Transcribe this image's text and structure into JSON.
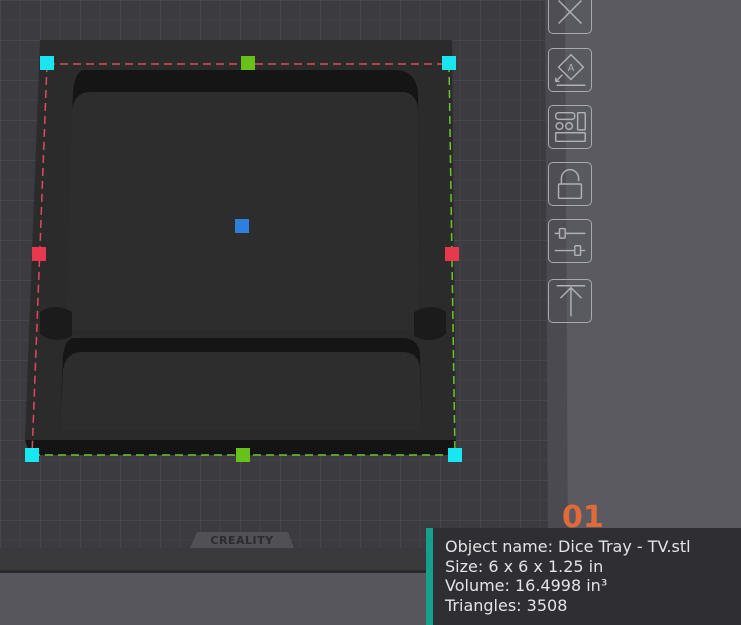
{
  "viewport": {
    "bed_logo": "CREALITY",
    "plate_number": "01"
  },
  "toolbar": {
    "tools": [
      {
        "name": "delete",
        "icon": "close-icon"
      },
      {
        "name": "auto-orient",
        "icon": "auto-orient-icon"
      },
      {
        "name": "arrange",
        "icon": "arrange-icon"
      },
      {
        "name": "lock",
        "icon": "unlock-icon"
      },
      {
        "name": "settings",
        "icon": "sliders-icon"
      },
      {
        "name": "place-on-face",
        "icon": "upload-arrow-icon"
      }
    ]
  },
  "object_info": {
    "name_line": "Object name: Dice Tray - TV.stl",
    "size_line": "Size: 6 x 6 x 1.25 in",
    "volume_line": "Volume: 16.4998 in³",
    "triangles_line": "Triangles: 3508"
  },
  "colors": {
    "accent": "#14a08c",
    "handle_corner": "#19e6f0",
    "handle_mid_green": "#66c21a",
    "handle_mid_red": "#e8384e",
    "handle_center": "#2f7fe0",
    "plate_number": "#e06a3a"
  }
}
